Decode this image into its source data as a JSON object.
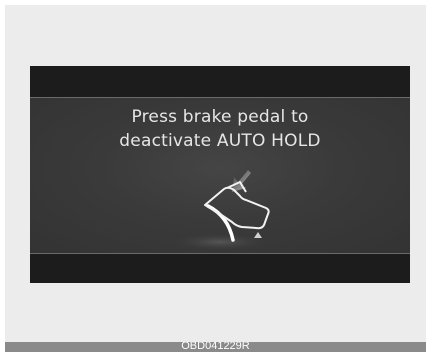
{
  "display": {
    "message_line1": "Press brake pedal to",
    "message_line2": "deactivate AUTO HOLD",
    "icon": "brake-pedal-icon"
  },
  "caption": {
    "code": "OBD041229R"
  },
  "colors": {
    "screen_background": "#333333",
    "bar_background": "#1c1c1c",
    "text": "#e6e6e6",
    "caption_bar": "#8a8a8a"
  }
}
